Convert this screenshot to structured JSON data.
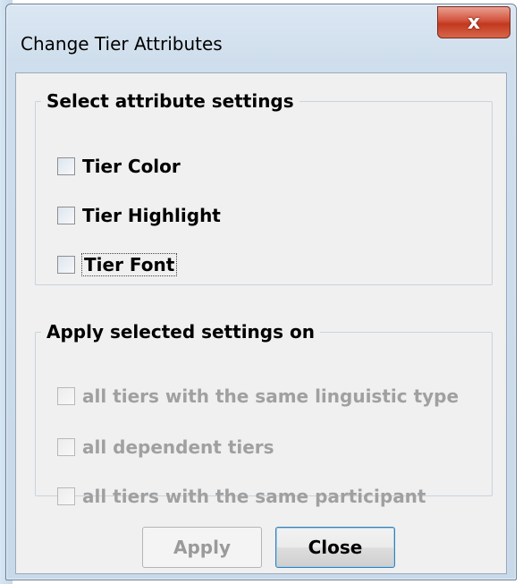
{
  "window": {
    "title": "Change Tier Attributes",
    "close_glyph": "x"
  },
  "attributes": {
    "legend": "Select attribute settings",
    "items": [
      {
        "label": "Tier Color",
        "checked": false
      },
      {
        "label": "Tier Highlight",
        "checked": false
      },
      {
        "label": "Tier Font",
        "checked": false,
        "focused": true
      }
    ]
  },
  "apply_on": {
    "legend": "Apply selected settings on",
    "items": [
      {
        "label": "all tiers with the same linguistic type",
        "checked": false,
        "enabled": false
      },
      {
        "label": "all dependent tiers",
        "checked": false,
        "enabled": false
      },
      {
        "label": "all tiers with the same participant",
        "checked": false,
        "enabled": false
      }
    ]
  },
  "buttons": {
    "apply": "Apply",
    "close": "Close"
  },
  "colors": {
    "dialog_bg": "#f0f0f0",
    "close_button_red": "#c2381e",
    "disabled_text": "#a0a0a0",
    "focus_button_border": "#3c7fb1"
  }
}
